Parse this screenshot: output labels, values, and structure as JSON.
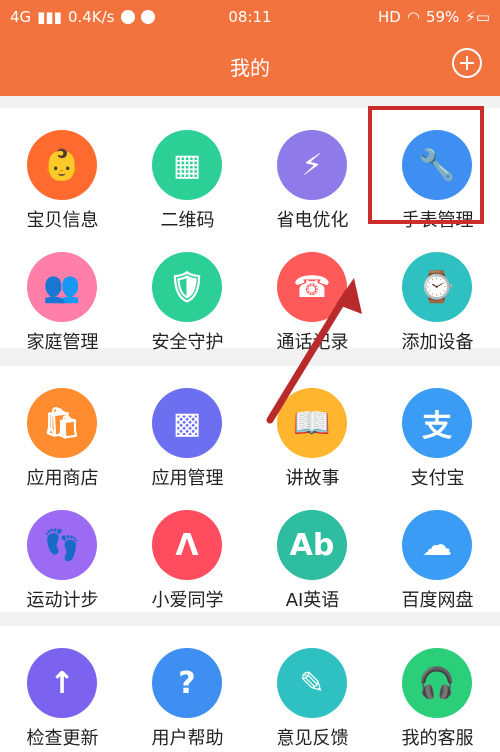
{
  "status": {
    "network": "4G",
    "speed": "0.4K/s",
    "time": "08:11",
    "hd": "HD",
    "battery": "59%"
  },
  "header": {
    "title": "我的"
  },
  "groups": [
    {
      "items": [
        {
          "label": "宝贝信息",
          "icon": "baby-info-icon",
          "bg": "#ff6b2f",
          "glyph": "👶"
        },
        {
          "label": "二维码",
          "icon": "qr-code-icon",
          "bg": "#2ccf96",
          "glyph": "▦"
        },
        {
          "label": "省电优化",
          "icon": "battery-icon",
          "bg": "#8e7ae8",
          "glyph": "⚡"
        },
        {
          "label": "手表管理",
          "icon": "wrench-icon",
          "bg": "#3f8ef1",
          "glyph": "🔧"
        },
        {
          "label": "家庭管理",
          "icon": "family-icon",
          "bg": "#ff7eaa",
          "glyph": "👥"
        },
        {
          "label": "安全守护",
          "icon": "shield-icon",
          "bg": "#2ccf96",
          "glyph": "🛡"
        },
        {
          "label": "通话记录",
          "icon": "call-log-icon",
          "bg": "#ff5a5a",
          "glyph": "☎"
        },
        {
          "label": "添加设备",
          "icon": "watch-icon",
          "bg": "#2fc1c2",
          "glyph": "⌚"
        }
      ]
    },
    {
      "items": [
        {
          "label": "应用商店",
          "icon": "store-icon",
          "bg": "#ff8c2f",
          "glyph": "🛍"
        },
        {
          "label": "应用管理",
          "icon": "apps-icon",
          "bg": "#6b6ff0",
          "glyph": "▩"
        },
        {
          "label": "讲故事",
          "icon": "book-icon",
          "bg": "#ffb52e",
          "glyph": "📖"
        },
        {
          "label": "支付宝",
          "icon": "alipay-icon",
          "bg": "#3a9cf5",
          "glyph": "支"
        },
        {
          "label": "运动计步",
          "icon": "footprint-icon",
          "bg": "#9b6cf3",
          "glyph": "👣"
        },
        {
          "label": "小爱同学",
          "icon": "xiaoai-icon",
          "bg": "#ff4d5f",
          "glyph": "Λ"
        },
        {
          "label": "AI英语",
          "icon": "english-book-icon",
          "bg": "#2ebd9e",
          "glyph": "Ab"
        },
        {
          "label": "百度网盘",
          "icon": "cloud-icon",
          "bg": "#3a9cf5",
          "glyph": "☁"
        }
      ]
    },
    {
      "items": [
        {
          "label": "检查更新",
          "icon": "update-arrow-icon",
          "bg": "#7b63f0",
          "glyph": "↑"
        },
        {
          "label": "用户帮助",
          "icon": "help-icon",
          "bg": "#3f8ef1",
          "glyph": "?"
        },
        {
          "label": "意见反馈",
          "icon": "feedback-icon",
          "bg": "#2fc1c2",
          "glyph": "✎"
        },
        {
          "label": "我的客服",
          "icon": "headset-icon",
          "bg": "#2ccf79",
          "glyph": "🎧"
        }
      ]
    }
  ]
}
